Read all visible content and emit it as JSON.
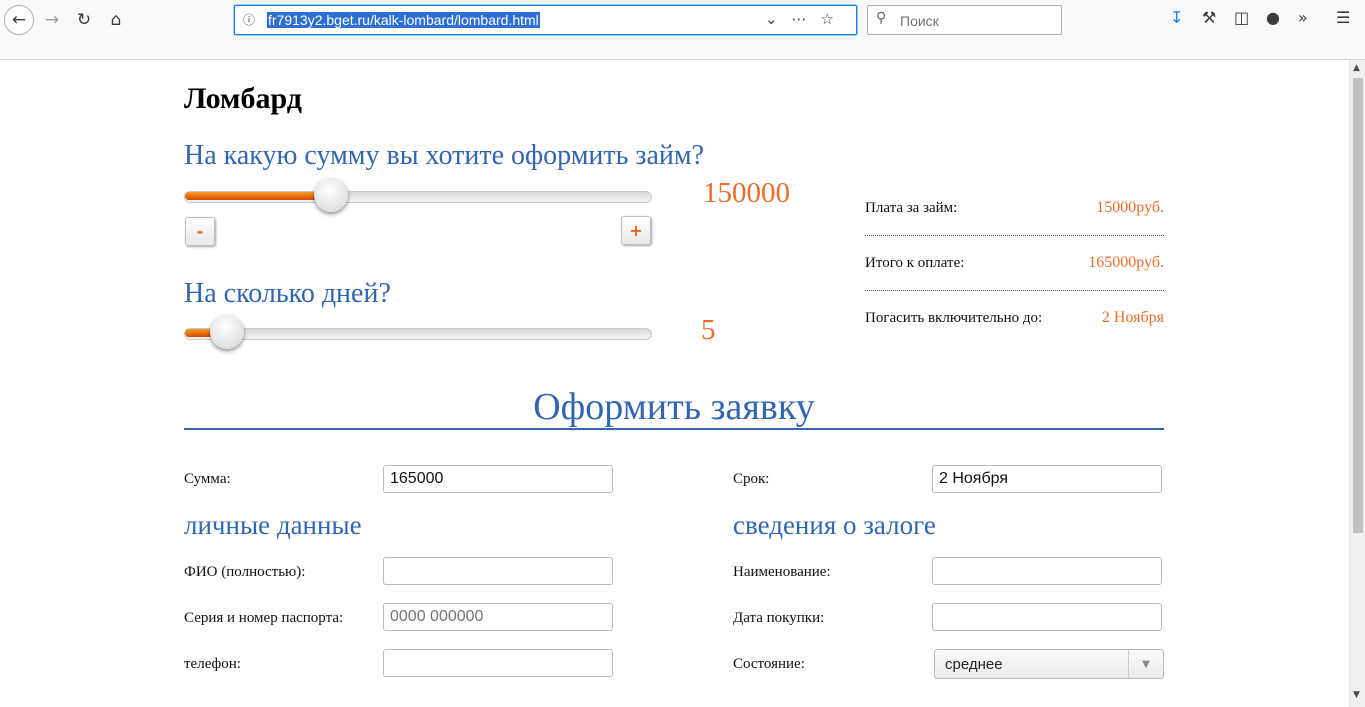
{
  "browser": {
    "url": "fr7913y2.bget.ru/kalk-lombard/lombard.html",
    "search_placeholder": "Поиск",
    "icons": [
      "back-icon",
      "forward-icon",
      "reload-icon",
      "home-icon",
      "site-info-icon",
      "dropdown-icon",
      "page-actions-icon",
      "bookmark-star-icon",
      "search-icon",
      "downloads-icon",
      "tools-icon",
      "sidebar-icon",
      "account-icon",
      "overflow-icon",
      "menu-icon"
    ]
  },
  "page": {
    "title": "Ломбард",
    "amount": {
      "question": "На какую сумму вы хотите оформить займ?",
      "value": "150000",
      "level": 0.3,
      "minus_label": "-",
      "plus_label": "+"
    },
    "days": {
      "question": "На сколько дней?",
      "value": "5",
      "level": 0.06
    },
    "summary": [
      {
        "label": "Плата за займ:",
        "value": "15000руб."
      },
      {
        "label": "Итого к оплате:",
        "value": "165000руб."
      },
      {
        "label": "Погасить включительно до:",
        "value": "2 Ноября"
      }
    ],
    "form": {
      "title": "Оформить заявку",
      "sum_label": "Сумма:",
      "sum_value": "165000",
      "term_label": "Срок:",
      "term_value": "2 Ноября",
      "personal_title": "личные данные",
      "collateral_title": "сведения о залоге",
      "fio_label": "ФИО (полностью):",
      "fio_value": "",
      "passport_label": "Серия и номер паспорта:",
      "passport_placeholder": "0000 000000",
      "phone_label": "телефон:",
      "phone_value": "",
      "name_label": "Наименование:",
      "name_value": "",
      "purchase_label": "Дата покупки:",
      "purchase_value": "",
      "condition_label": "Состояние:",
      "condition_value": "среднее"
    }
  },
  "colors": {
    "accent_blue": "#3266b0",
    "accent_orange": "#ec6d2b"
  }
}
